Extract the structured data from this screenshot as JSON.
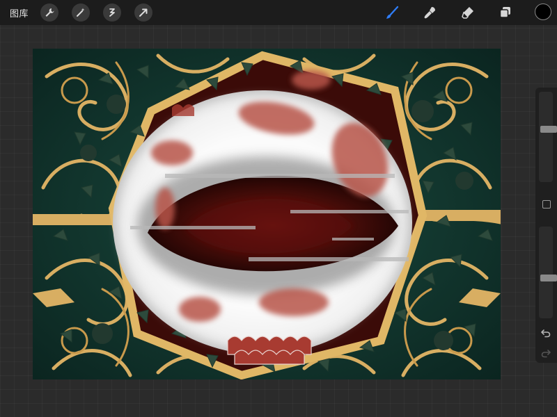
{
  "toolbar": {
    "gallery_label": "图库",
    "left_tools": [
      "wrench-icon",
      "magic-wand-icon",
      "selection-icon",
      "transform-arrow-icon"
    ],
    "right_tools": [
      "brush-icon",
      "smudge-icon",
      "eraser-icon",
      "layers-icon"
    ],
    "active_tool": "brush",
    "active_color": "#000000",
    "accent": "#2f7df6"
  },
  "sidebar": {
    "brush_size": 0.7,
    "opacity": 0.6,
    "controls": [
      "square-modify-icon",
      "undo-icon",
      "redo-icon"
    ]
  },
  "canvas": {
    "palette": {
      "background": "#11332c",
      "gold": "#d8ae62",
      "leaf": "#2d4a3c",
      "white": "#f2f2f2",
      "blood": "#b8554a",
      "dark_red": "#3d0b08"
    }
  }
}
